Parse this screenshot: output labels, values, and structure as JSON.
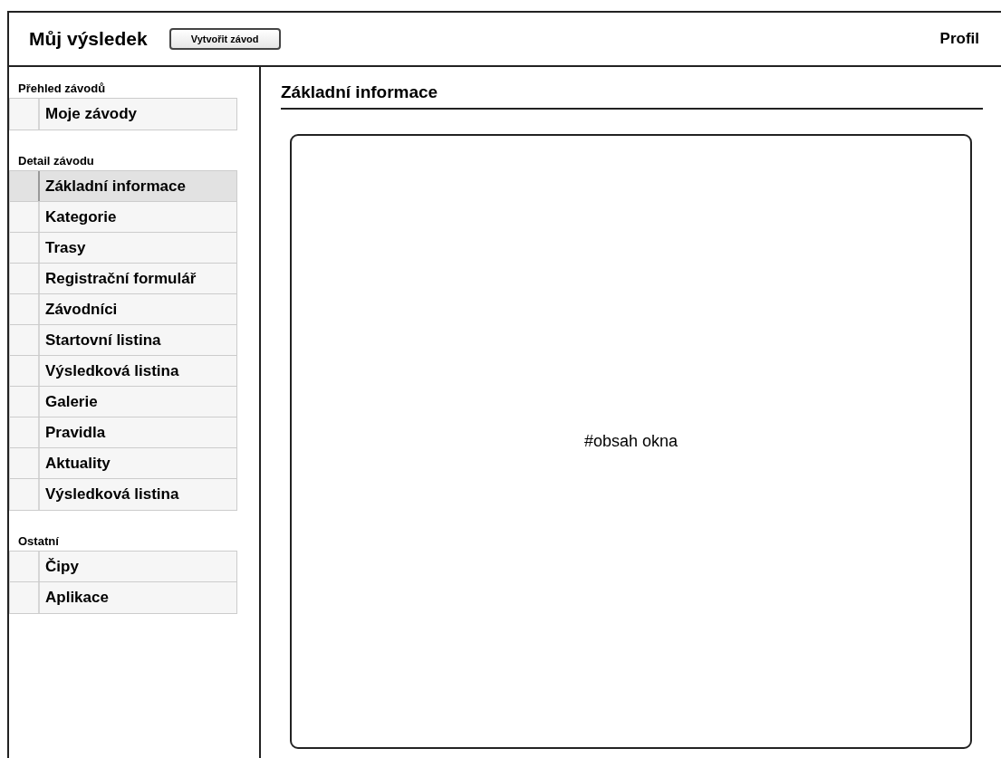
{
  "header": {
    "title": "Můj výsledek",
    "create_button": "Vytvořit závod",
    "profile": "Profil"
  },
  "sidebar": {
    "sections": [
      {
        "title": "Přehled závodů",
        "items": [
          {
            "label": "Moje závody",
            "selected": false
          }
        ]
      },
      {
        "title": "Detail závodu",
        "items": [
          {
            "label": "Základní informace",
            "selected": true
          },
          {
            "label": "Kategorie",
            "selected": false
          },
          {
            "label": "Trasy",
            "selected": false
          },
          {
            "label": "Registrační formulář",
            "selected": false
          },
          {
            "label": "Závodníci",
            "selected": false
          },
          {
            "label": "Startovní listina",
            "selected": false
          },
          {
            "label": "Výsledková listina",
            "selected": false
          },
          {
            "label": "Galerie",
            "selected": false
          },
          {
            "label": "Pravidla",
            "selected": false
          },
          {
            "label": "Aktuality",
            "selected": false
          },
          {
            "label": "Výsledková listina",
            "selected": false
          }
        ]
      },
      {
        "title": "Ostatní",
        "items": [
          {
            "label": "Čipy",
            "selected": false
          },
          {
            "label": "Aplikace",
            "selected": false
          }
        ]
      }
    ]
  },
  "content": {
    "heading": "Základní informace",
    "panel_text": "#obsah okna"
  }
}
